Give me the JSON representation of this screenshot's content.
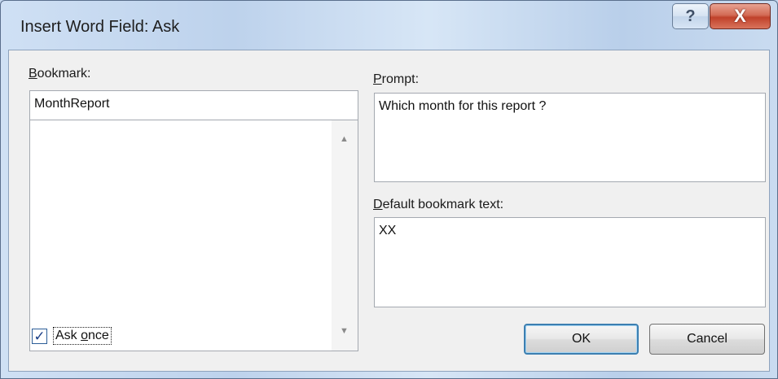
{
  "window": {
    "title": "Insert Word Field: Ask",
    "help_glyph": "?",
    "close_glyph": "X"
  },
  "bookmark": {
    "label_accel": "B",
    "label_rest": "ookmark:",
    "value": "MonthReport",
    "list_items": []
  },
  "prompt": {
    "label_accel": "P",
    "label_rest": "rompt:",
    "value": "Which month for this report ?"
  },
  "default_text": {
    "label_accel": "D",
    "label_rest": "efault bookmark text:",
    "value": "XX"
  },
  "ask_once": {
    "label_pre": "Ask ",
    "label_accel": "o",
    "label_rest": "nce",
    "checked": true,
    "check_glyph": "✓"
  },
  "buttons": {
    "ok_label": "OK",
    "cancel_label": "Cancel"
  },
  "icons": {
    "scroll_up": "scroll-up-arrow-icon",
    "scroll_down": "scroll-down-arrow-icon",
    "help": "help-icon",
    "close": "close-icon"
  }
}
